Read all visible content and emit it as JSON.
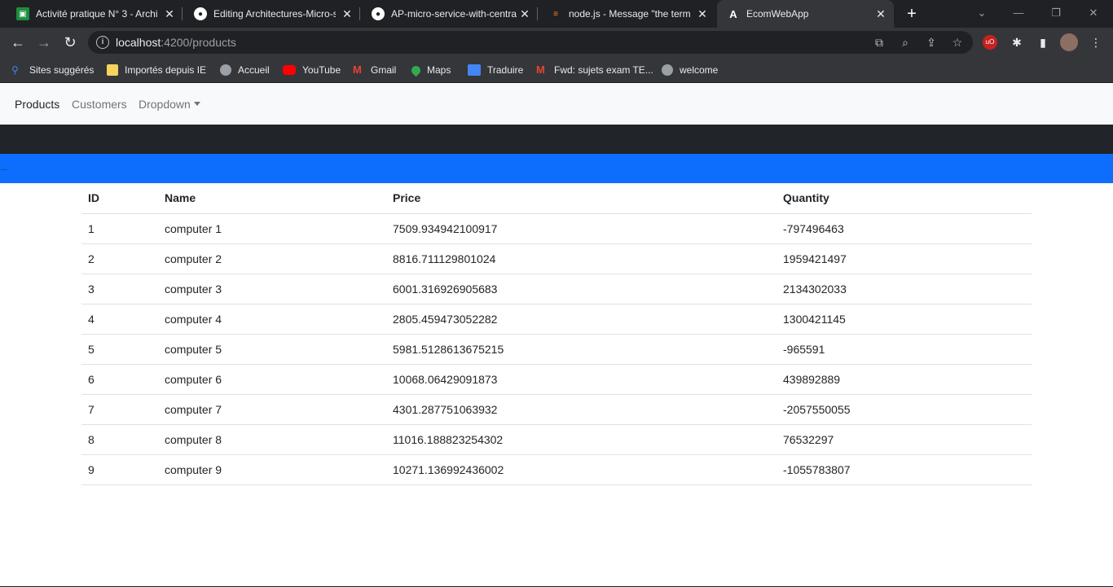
{
  "browser": {
    "tabs": [
      {
        "title": "Activité pratique N° 3 - Archi",
        "icon": "classroom-icon",
        "color": "#1e8e3e"
      },
      {
        "title": "Editing Architectures-Micro-s",
        "icon": "github-icon",
        "color": "#ffffff"
      },
      {
        "title": "AP-micro-service-with-centra",
        "icon": "github-icon",
        "color": "#ffffff"
      },
      {
        "title": "node.js - Message \"the term",
        "icon": "stackoverflow-icon",
        "color": "#f48024"
      },
      {
        "title": "EcomWebApp",
        "icon": "angular-icon",
        "color": "#ffffff"
      }
    ],
    "new_tab": "+",
    "url_host": "localhost",
    "url_rest": ":4200/products",
    "bookmarks": [
      {
        "label": "Sites suggérés",
        "icon": "search-icon",
        "color": "#4285f4"
      },
      {
        "label": "Importés depuis IE",
        "icon": "folder-icon",
        "color": "#f4d35e"
      },
      {
        "label": "Accueil",
        "icon": "globe-icon",
        "color": "#9aa0a6"
      },
      {
        "label": "YouTube",
        "icon": "youtube-icon",
        "color": "#ff0000"
      },
      {
        "label": "Gmail",
        "icon": "gmail-icon",
        "color": "#ea4335"
      },
      {
        "label": "Maps",
        "icon": "maps-icon",
        "color": "#34a853"
      },
      {
        "label": "Traduire",
        "icon": "translate-icon",
        "color": "#4285f4"
      },
      {
        "label": "Fwd: sujets exam TE...",
        "icon": "gmail-icon",
        "color": "#ea4335"
      },
      {
        "label": "welcome",
        "icon": "globe-icon",
        "color": "#9aa0a6"
      }
    ]
  },
  "app": {
    "nav": {
      "products": "Products",
      "customers": "Customers",
      "dropdown": "Dropdown"
    },
    "loading_text": "...",
    "table": {
      "headers": {
        "id": "ID",
        "name": "Name",
        "price": "Price",
        "quantity": "Quantity"
      },
      "rows": [
        {
          "id": "1",
          "name": "computer 1",
          "price": "7509.934942100917",
          "quantity": "-797496463"
        },
        {
          "id": "2",
          "name": "computer 2",
          "price": "8816.711129801024",
          "quantity": "1959421497"
        },
        {
          "id": "3",
          "name": "computer 3",
          "price": "6001.316926905683",
          "quantity": "2134302033"
        },
        {
          "id": "4",
          "name": "computer 4",
          "price": "2805.459473052282",
          "quantity": "1300421145"
        },
        {
          "id": "5",
          "name": "computer 5",
          "price": "5981.5128613675215",
          "quantity": "-965591"
        },
        {
          "id": "6",
          "name": "computer 6",
          "price": "10068.06429091873",
          "quantity": "439892889"
        },
        {
          "id": "7",
          "name": "computer 7",
          "price": "4301.287751063932",
          "quantity": "-2057550055"
        },
        {
          "id": "8",
          "name": "computer 8",
          "price": "11016.188823254302",
          "quantity": "76532297"
        },
        {
          "id": "9",
          "name": "computer 9",
          "price": "10271.136992436002",
          "quantity": "-1055783807"
        }
      ]
    }
  },
  "colors": {
    "navbar_bg": "#f8f9fa",
    "dark_band": "#212529",
    "primary_band": "#0d6efd"
  }
}
